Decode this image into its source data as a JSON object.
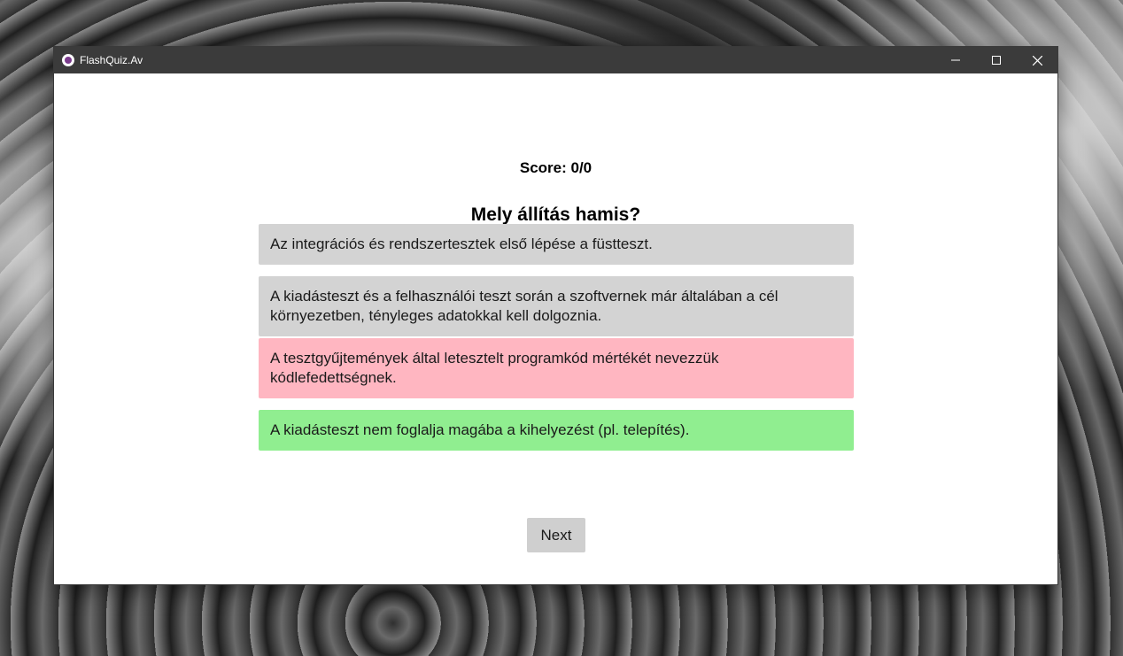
{
  "window": {
    "title": "FlashQuiz.Av",
    "controls": {
      "minimize": "—",
      "maximize": "☐",
      "close": "✕"
    }
  },
  "quiz": {
    "score": "Score: 0/0",
    "question": "Mely állítás hamis?",
    "answers": [
      {
        "text": "Az integrációs és rendszertesztek első lépése a füstteszt.",
        "color": "#d3d3d3"
      },
      {
        "text": "A kiadásteszt és a felhasználói teszt során a szoftvernek már általában a cél környezetben, tényleges adatokkal kell dolgoznia.",
        "color": "#d3d3d3"
      },
      {
        "text": "A tesztgyűjtemények által letesztelt programkód mértékét nevezzük kódlefedettségnek.",
        "color": "#ffb6c1"
      },
      {
        "text": "A kiadásteszt nem foglalja magába a kihelyezést (pl. telepítés).",
        "color": "#90ee90"
      }
    ],
    "next_label": "Next"
  }
}
